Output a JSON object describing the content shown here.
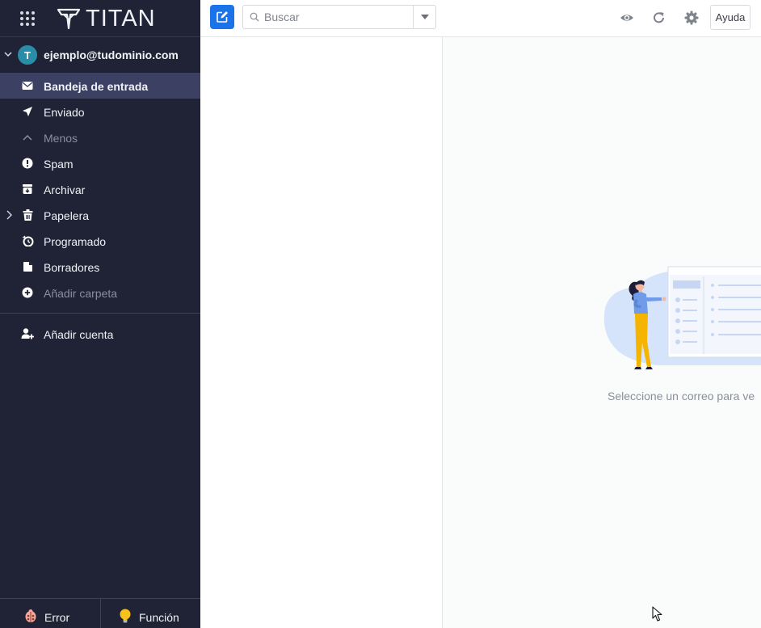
{
  "brand": {
    "name": "TITAN"
  },
  "account": {
    "avatar_initial": "T",
    "email": "ejemplo@tudominio.com",
    "avatar_color": "#2a8da8"
  },
  "folders": [
    {
      "label": "Bandeja de entrada",
      "icon": "envelope-icon",
      "active": true
    },
    {
      "label": "Enviado",
      "icon": "paper-plane-icon"
    },
    {
      "label": "Menos",
      "icon": "chevron-up-icon",
      "muted": true
    },
    {
      "label": "Spam",
      "icon": "alert-circle-icon"
    },
    {
      "label": "Archivar",
      "icon": "archive-icon"
    },
    {
      "label": "Papelera",
      "icon": "trash-icon",
      "expandable": true
    },
    {
      "label": "Programado",
      "icon": "clock-icon"
    },
    {
      "label": "Borradores",
      "icon": "draft-icon"
    },
    {
      "label": "Añadir carpeta",
      "icon": "plus-circle-icon",
      "muted": true
    }
  ],
  "add_account": {
    "label": "Añadir cuenta"
  },
  "footer": {
    "error_label": "Error",
    "feature_label": "Función"
  },
  "toolbar": {
    "search_placeholder": "Buscar",
    "help_label": "Ayuda",
    "icons": [
      "compose-icon",
      "eye-icon",
      "refresh-icon",
      "settings-icon"
    ]
  },
  "reading_pane": {
    "empty_message": "Seleccione un correo para ve"
  },
  "colors": {
    "sidebar_bg": "#1f2335",
    "sidebar_active": "#3c4063",
    "accent": "#1a73e8",
    "illustration_blue": "#d6e4fb",
    "illustration_yellow": "#f5b400"
  }
}
